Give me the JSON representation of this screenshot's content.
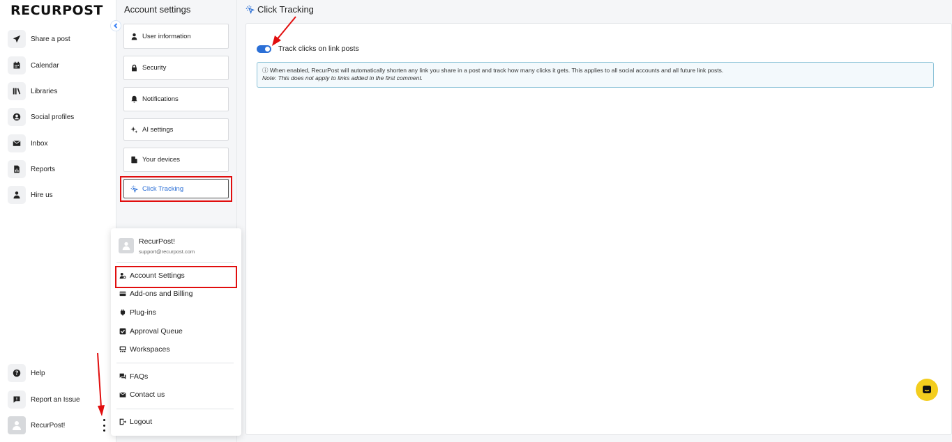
{
  "app": {
    "logo_text": "RECURPOST"
  },
  "sidebar": {
    "items": [
      {
        "label": "Share a post",
        "icon": "send-icon"
      },
      {
        "label": "Calendar",
        "icon": "calendar-icon"
      },
      {
        "label": "Libraries",
        "icon": "library-icon"
      },
      {
        "label": "Social profiles",
        "icon": "social-profiles-icon"
      },
      {
        "label": "Inbox",
        "icon": "inbox-icon"
      },
      {
        "label": "Reports",
        "icon": "reports-icon"
      },
      {
        "label": "Hire us",
        "icon": "person-icon"
      }
    ],
    "bottom": [
      {
        "label": "Help",
        "icon": "help-icon"
      },
      {
        "label": "Report an Issue",
        "icon": "report-issue-icon"
      }
    ],
    "user_name": "RecurPost!"
  },
  "settings": {
    "title": "Account settings",
    "items": [
      {
        "label": "User information",
        "icon": "user-icon"
      },
      {
        "label": "Security",
        "icon": "lock-icon"
      },
      {
        "label": "Notifications",
        "icon": "bell-icon"
      },
      {
        "label": "AI settings",
        "icon": "sparkle-icon"
      },
      {
        "label": "Your devices",
        "icon": "devices-icon"
      },
      {
        "label": "Click Tracking",
        "icon": "click-cursor-icon",
        "active": true
      }
    ]
  },
  "main": {
    "title": "Click Tracking",
    "toggle_label": "Track clicks on link posts",
    "toggle_on": true,
    "info_text": "ⓘ When enabled, RecurPost will automatically shorten any link you share in a post and track how many clicks it gets. This applies to all social accounts and all future link posts.",
    "info_note": "Note: This does not apply to links added in the first comment."
  },
  "menu": {
    "user_name": "RecurPost!",
    "user_email": "support@recurpost.com",
    "items": [
      {
        "label": "Account Settings",
        "icon": "account-settings-icon"
      },
      {
        "label": "Add-ons and Billing",
        "icon": "billing-icon"
      },
      {
        "label": "Plug-ins",
        "icon": "plugin-icon"
      },
      {
        "label": "Approval Queue",
        "icon": "approval-icon"
      },
      {
        "label": "Workspaces",
        "icon": "workspaces-icon"
      }
    ],
    "support_items": [
      {
        "label": "FAQs",
        "icon": "faq-icon"
      },
      {
        "label": "Contact us",
        "icon": "contact-icon"
      }
    ],
    "logout_label": "Logout"
  },
  "colors": {
    "accent": "#2b6fd6",
    "highlight": "#e10e0e",
    "chat_bubble": "#f3cd1e"
  }
}
